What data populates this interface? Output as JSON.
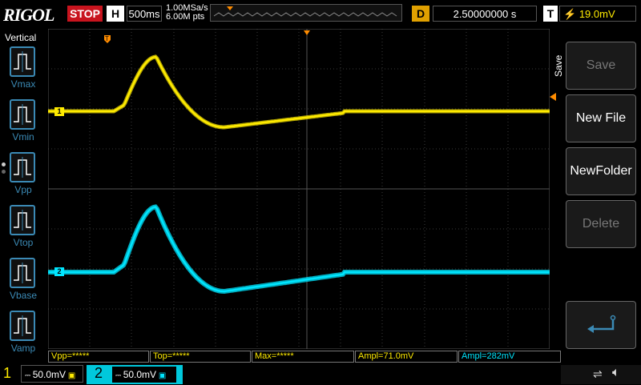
{
  "top": {
    "logo": "RIGOL",
    "run_state": "STOP",
    "h_key": "H",
    "timebase": "500ms",
    "sample_rate": "1.00MSa/s",
    "memory_depth": "6.00M pts",
    "d_key": "D",
    "delay": "2.50000000 s",
    "t_key": "T",
    "trigger_level": "19.0mV"
  },
  "left_menu": {
    "title": "Vertical",
    "items": [
      "Vmax",
      "Vmin",
      "Vpp",
      "Vtop",
      "Vbase",
      "Vamp"
    ]
  },
  "right_menu": {
    "title": "Save",
    "buttons": [
      "Save",
      "New File",
      "NewFolder",
      "Delete"
    ]
  },
  "measurements": [
    "Vpp=*****",
    "Top=*****",
    "Max=*****",
    "Ampl=71.0mV",
    "Ampl=282mV"
  ],
  "channels": {
    "ch1_label": "1",
    "ch1_scale": "50.0mV",
    "ch2_label": "2",
    "ch2_scale": "50.0mV"
  },
  "colors": {
    "ch1": "#ffeb00",
    "ch2": "#00e6ff",
    "accent": "#3b8ab5",
    "trigger": "#ff8c00"
  }
}
